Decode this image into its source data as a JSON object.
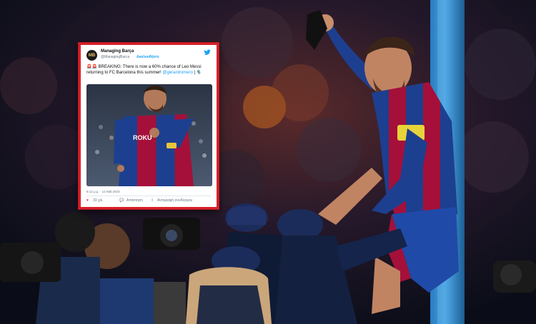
{
  "tweet": {
    "avatar_text": "MB",
    "name": "Managing Barça",
    "handle": "@ManagingBarca",
    "follow": "Ακολουθήστε",
    "alarm": "🚨🚨",
    "text_main": "BREAKING: There is now a 60% chance of Leo Messi returning to FC Barcelona this summer!",
    "mention": "@gerardromero",
    "text_tail": "| 🎙️",
    "meta": "8:12 μ.μ. · 14 Μαΐ 2023",
    "likes": "33 χιλ.",
    "reply": "Απάντηση",
    "copy": "Αντιγραφή συνδέσμου",
    "shirt_text": "ROKU"
  },
  "photo": {
    "shirt_text": "ROKU"
  }
}
